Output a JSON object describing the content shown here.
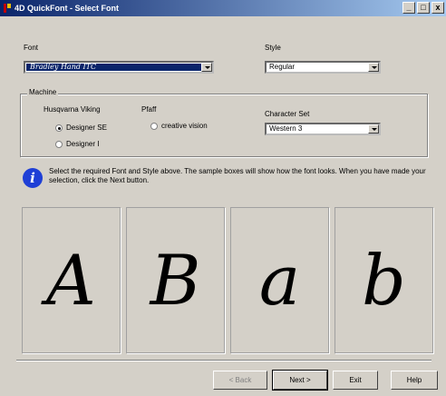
{
  "window": {
    "title": "4D QuickFont - Select Font",
    "controls": [
      "_",
      "□",
      "x"
    ]
  },
  "font": {
    "label": "Font",
    "value": "Bradley Hand ITC"
  },
  "style": {
    "label": "Style",
    "value": "Regular"
  },
  "machine": {
    "label": "Machine",
    "husqvarna_label": "Husqvarna Viking",
    "pfaff_label": "Pfaff",
    "options": [
      {
        "label": "Designer SE",
        "checked": true
      },
      {
        "label": "Designer I",
        "checked": false
      },
      {
        "label": "creative vision",
        "checked": false
      }
    ]
  },
  "character_set": {
    "label": "Character Set",
    "value": "Western 3"
  },
  "info": {
    "icon_letter": "i",
    "text": "Select the required Font and Style above. The sample boxes will show how the font looks. When you have made your selection, click the Next button."
  },
  "samples": [
    "A",
    "B",
    "a",
    "b"
  ],
  "buttons": {
    "back": "< Back",
    "next": "Next >",
    "exit": "Exit",
    "help": "Help"
  }
}
